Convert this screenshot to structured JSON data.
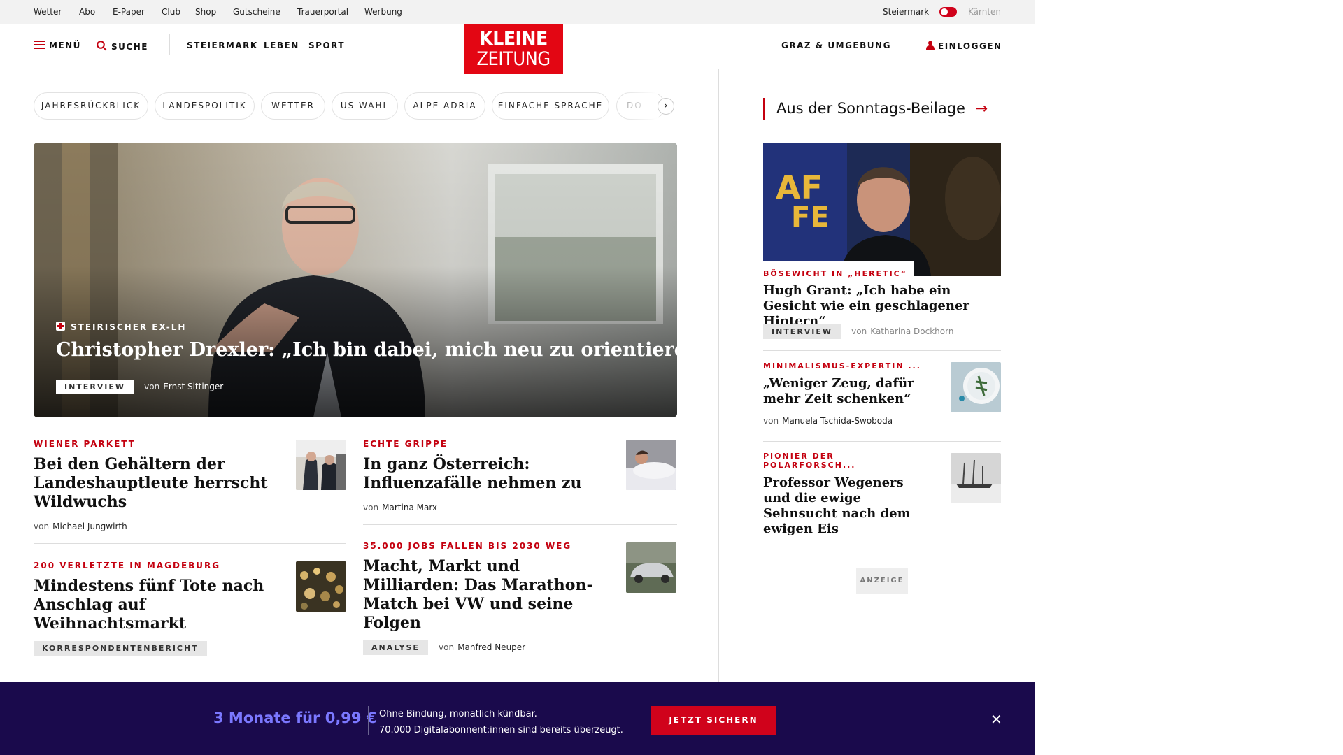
{
  "topbar": {
    "links": [
      "Wetter",
      "Abo",
      "E-Paper",
      "Club",
      "Shop",
      "Gutscheine",
      "Trauerportal",
      "Werbung"
    ],
    "region_active": "Steiermark",
    "region_inactive": "Kärnten"
  },
  "header": {
    "menu_label": "MENÜ",
    "search_label": "SUCHE",
    "nav": [
      "STEIERMARK",
      "LEBEN",
      "SPORT"
    ],
    "logo_line1": "KLEINE",
    "logo_line2": "ZEITUNG",
    "region_link": "GRAZ & UMGEBUNG",
    "login_label": "EINLOGGEN"
  },
  "topics": [
    "JAHRESRÜCKBLICK",
    "LANDESPOLITIK",
    "WETTER",
    "US-WAHL",
    "ALPE ADRIA",
    "EINFACHE SPRACHE",
    "DO"
  ],
  "hero": {
    "kicker": "STEIRISCHER EX-LH",
    "title": "Christopher Drexler: „Ich bin dabei, mich neu zu orientieren“",
    "badge": "INTERVIEW",
    "byline_prefix": "von",
    "author": "Ernst Sittinger"
  },
  "articles": [
    {
      "kicker": "WIENER PARKETT",
      "title": "Bei den Gehältern der Landeshauptleute herrscht Wildwuchs",
      "byline_prefix": "von",
      "author": "Michael Jungwirth"
    },
    {
      "kicker": "ECHTE GRIPPE",
      "title": "In ganz Österreich: Influenzafälle nehmen zu",
      "byline_prefix": "von",
      "author": "Martina Marx"
    },
    {
      "kicker": "200 VERLETZTE IN MAGDEBURG",
      "title": "Mindestens fünf Tote nach Anschlag auf Weihnachtsmarkt",
      "badge": "KORRESPONDENTENBERICHT"
    },
    {
      "kicker": "35.000 JOBS FALLEN BIS 2030 WEG",
      "title": "Macht, Markt und Milliarden: Das Marathon-Match bei VW und seine Folgen",
      "badge": "ANALYSE",
      "byline_prefix": "von",
      "author": "Manfred Neuper"
    }
  ],
  "sidebar": {
    "title": "Aus der Sonntags-Beilage",
    "feature": {
      "kicker": "BÖSEWICHT IN „HERETIC“",
      "title": "Hugh Grant: „Ich habe ein Gesicht wie ein geschlagener Hintern“",
      "badge": "INTERVIEW",
      "byline_prefix": "von",
      "author": "Katharina Dockhorn"
    },
    "items": [
      {
        "kicker": "MINIMALISMUS-EXPERTIN ...",
        "title": "„Weniger Zeug, dafür mehr Zeit schenken“",
        "byline_prefix": "von",
        "author": "Manuela Tschida-Swoboda"
      },
      {
        "kicker": "PIONIER DER POLARFORSCH...",
        "title": "Professor Wegeners und die ewige Sehnsucht nach dem ewigen Eis"
      }
    ],
    "ad_label": "ANZEIGE"
  },
  "promo": {
    "offer": "3 Monate für 0,99 €",
    "line1": "Ohne Bindung, monatlich kündbar.",
    "line2": "70.000 Digitalabonnent:innen sind bereits überzeugt.",
    "cta": "JETZT SICHERN",
    "close": "✕"
  },
  "colors": {
    "brand_red": "#e30613",
    "kicker_red": "#c4000f",
    "promo_bg": "#1a0a4c",
    "promo_accent": "#7b78ff"
  }
}
